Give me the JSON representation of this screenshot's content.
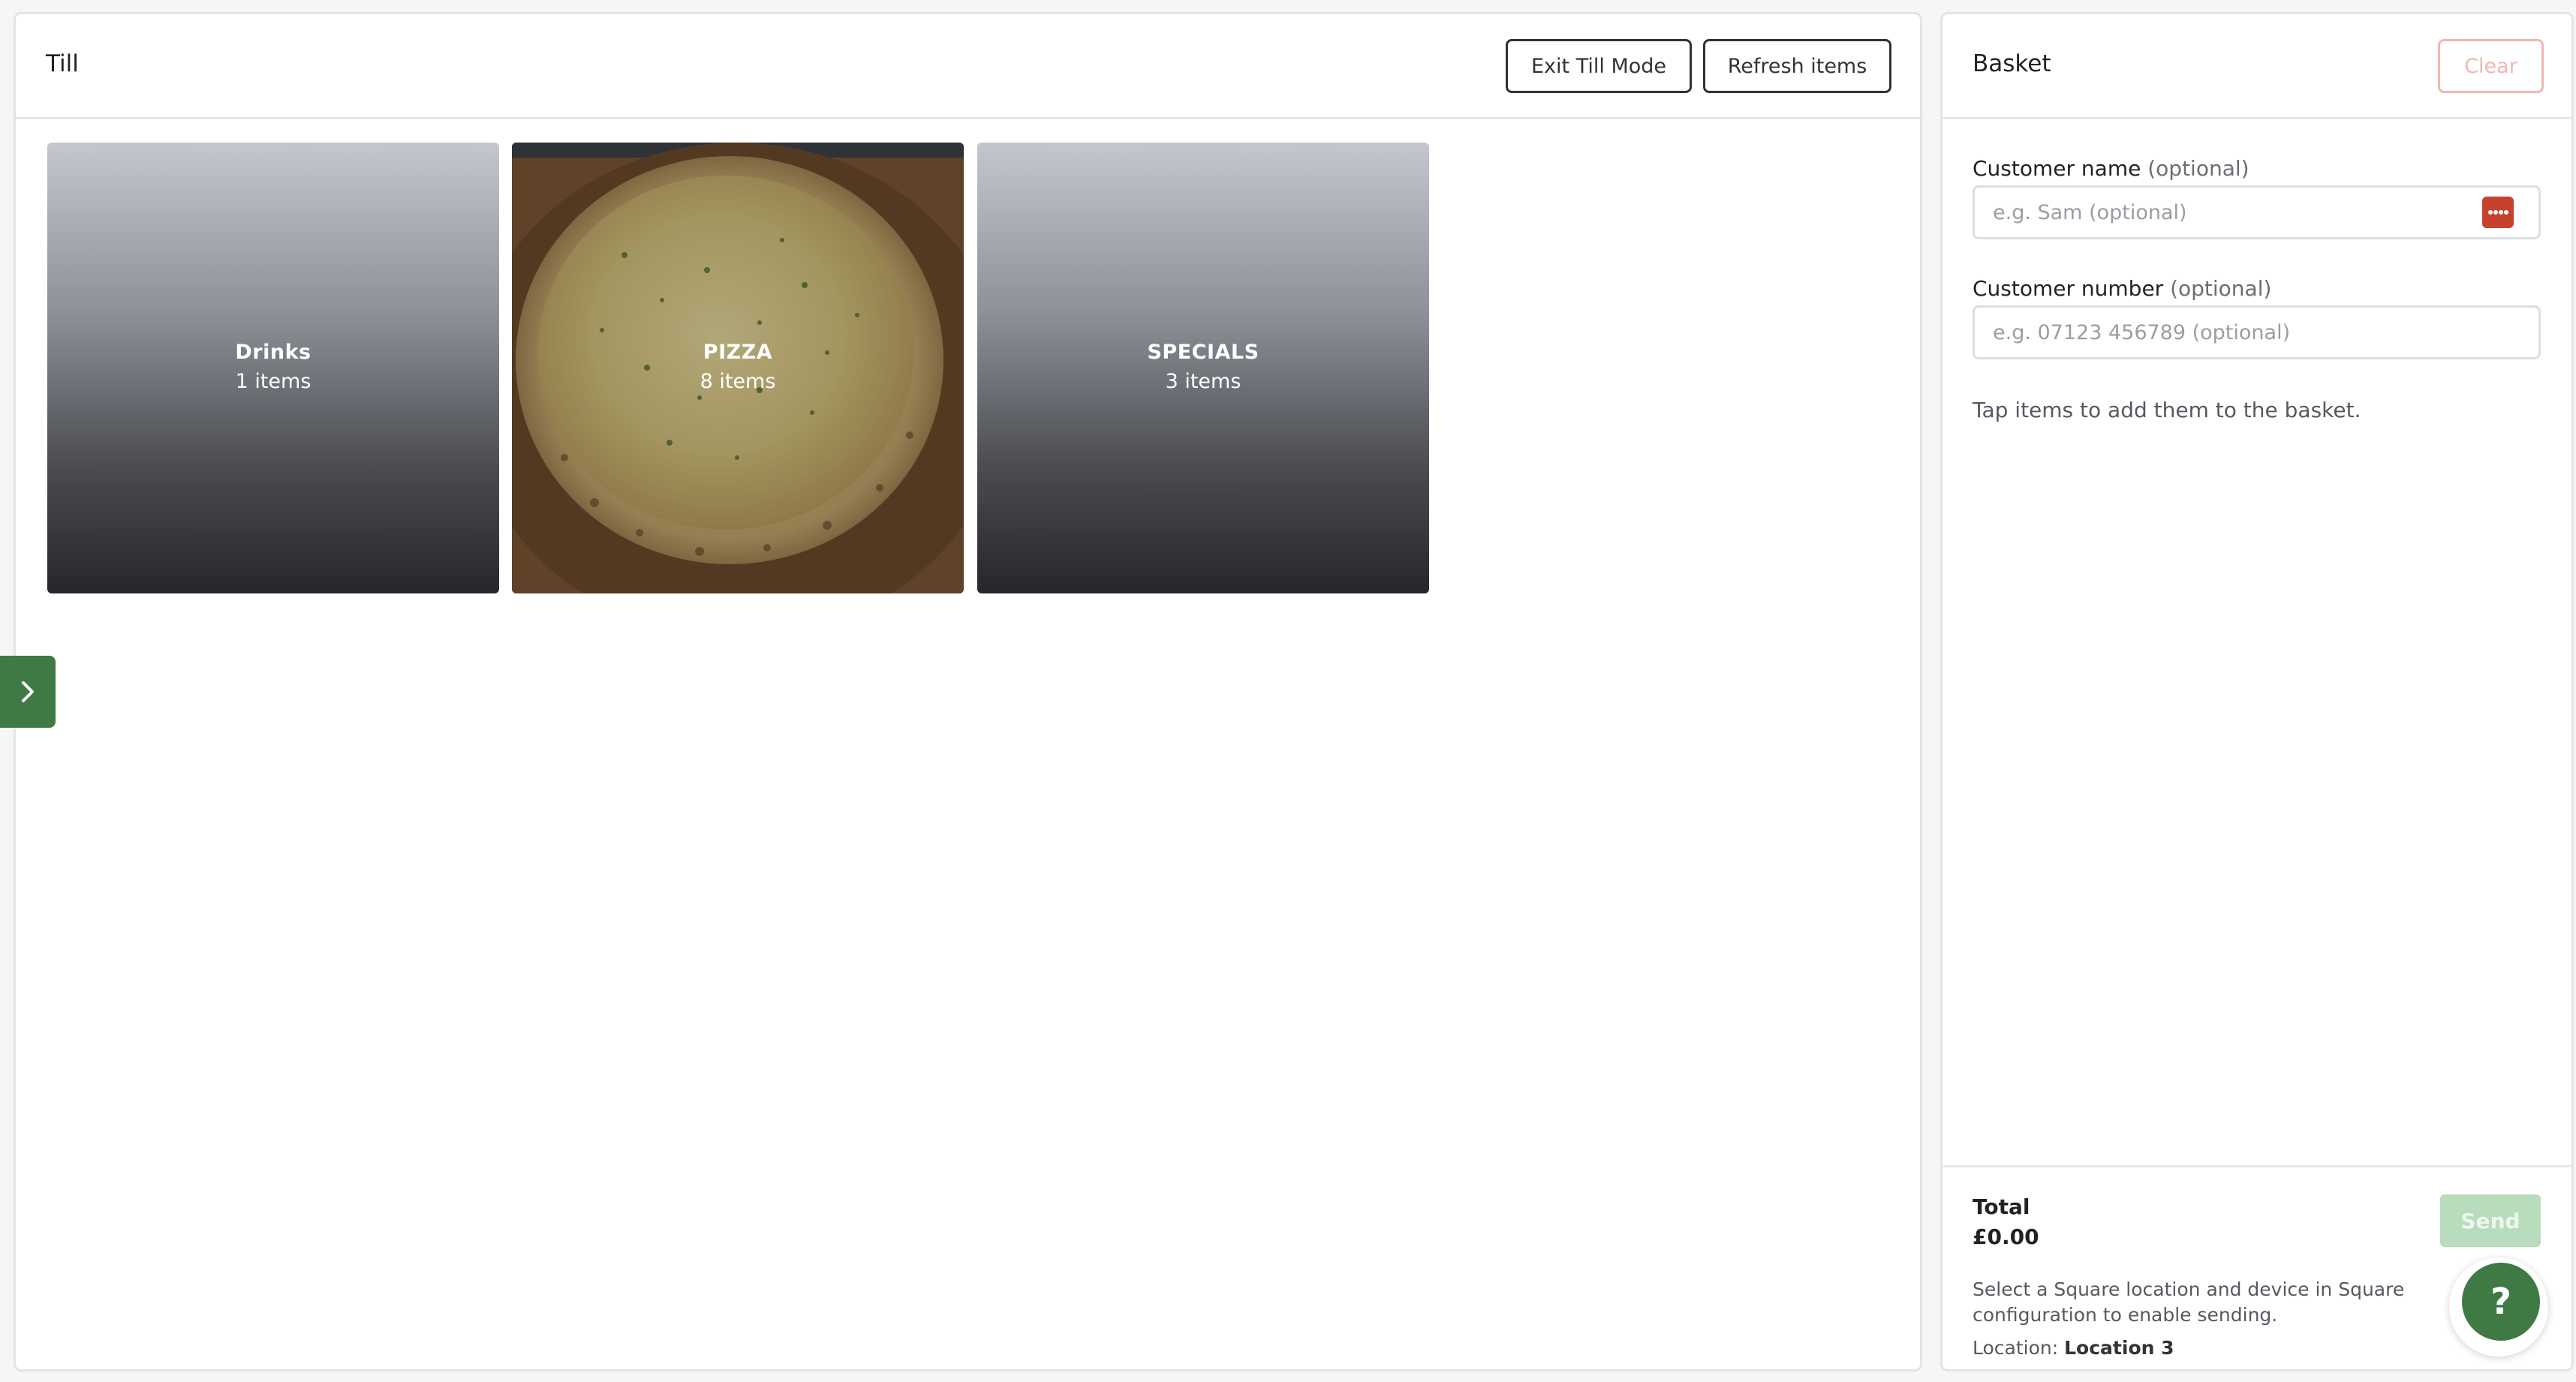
{
  "till": {
    "title": "Till",
    "exit_label": "Exit Till Mode",
    "refresh_label": "Refresh items",
    "categories": [
      {
        "name": "Drinks",
        "count": "1 items"
      },
      {
        "name": "PIZZA",
        "count": "8 items"
      },
      {
        "name": "SPECIALS",
        "count": "3 items"
      }
    ]
  },
  "basket": {
    "title": "Basket",
    "clear_label": "Clear",
    "customer_name": {
      "label": "Customer name",
      "optional": "(optional)",
      "placeholder": "e.g. Sam (optional)",
      "value": ""
    },
    "customer_number": {
      "label": "Customer number",
      "optional": "(optional)",
      "placeholder": "e.g. 07123 456789 (optional)",
      "value": ""
    },
    "hint": "Tap items to add them to the basket.",
    "total_label": "Total",
    "total_value": "£0.00",
    "send_label": "Send",
    "send_note": "Select a Square location and device in Square configuration to enable sending.",
    "location_label": "Location:",
    "location_value": "Location 3"
  },
  "help_label": "?",
  "icons": {
    "sidebar_toggle": "chevron-right-icon",
    "keypad": "password-manager-icon"
  },
  "colors": {
    "accent_green": "#3f7a45",
    "send_disabled": "#b9dcbd",
    "clear_disabled": "#f1b6b0",
    "keypad_red": "#c7412f"
  }
}
